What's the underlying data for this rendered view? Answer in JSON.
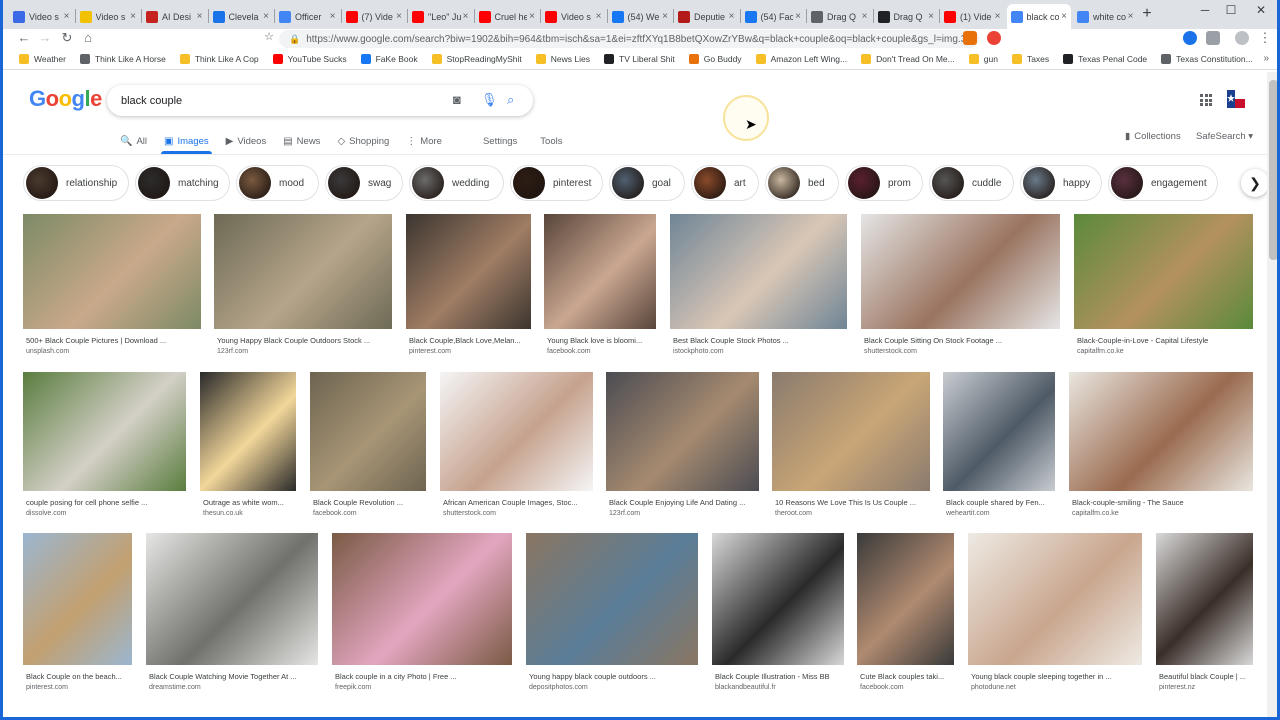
{
  "browser": {
    "tabs": [
      {
        "title": "Video s",
        "fav": "#3c6ae6"
      },
      {
        "title": "Video s",
        "fav": "#f2c200"
      },
      {
        "title": "AI Desi",
        "fav": "#c5221f"
      },
      {
        "title": "Clevela",
        "fav": "#1a73e8"
      },
      {
        "title": "Officer",
        "fav": "#4285f4"
      },
      {
        "title": "(7) Vide",
        "fav": "#ff0000"
      },
      {
        "title": "\"Leo\" Ju",
        "fav": "#ff0000"
      },
      {
        "title": "Cruel he",
        "fav": "#ff0000"
      },
      {
        "title": "Video s",
        "fav": "#ff0000"
      },
      {
        "title": "(54) We",
        "fav": "#1877f2"
      },
      {
        "title": "Deputie",
        "fav": "#b31b1b"
      },
      {
        "title": "(54) Fac",
        "fav": "#1877f2"
      },
      {
        "title": "Drag Q",
        "fav": "#5f6368"
      },
      {
        "title": "Drag Q",
        "fav": "#202124"
      },
      {
        "title": "(1) Vide",
        "fav": "#ff0000"
      },
      {
        "title": "black co",
        "fav": "#4285f4",
        "active": true
      },
      {
        "title": "white co",
        "fav": "#4285f4"
      }
    ],
    "url": "https://www.google.com/search?biw=1902&bih=964&tbm=isch&sa=1&ei=zftfXYq1B8betQXowZrYBw&q=black+couple&oq=black+couple&gs_l=img.3...0...",
    "bookmarks": [
      {
        "label": "Weather",
        "color": "#f6bf26"
      },
      {
        "label": "Think Like A Horse",
        "color": "#5f6368"
      },
      {
        "label": "Think Like A Cop",
        "color": "#f6bf26"
      },
      {
        "label": "YouTube Sucks",
        "color": "#ff0000"
      },
      {
        "label": "FaKe Book",
        "color": "#1877f2"
      },
      {
        "label": "StopReadingMyShit",
        "color": "#f6bf26"
      },
      {
        "label": "News Lies",
        "color": "#f6bf26"
      },
      {
        "label": "TV Liberal Shit",
        "color": "#202124"
      },
      {
        "label": "Go Buddy",
        "color": "#e8710a"
      },
      {
        "label": "Amazon Left Wing...",
        "color": "#f6bf26"
      },
      {
        "label": "Don't Tread On Me...",
        "color": "#f6bf26"
      },
      {
        "label": "gun",
        "color": "#f6bf26"
      },
      {
        "label": "Taxes",
        "color": "#f6bf26"
      },
      {
        "label": "Texas Penal Code",
        "color": "#202124"
      },
      {
        "label": "Texas Constitution...",
        "color": "#5f6368"
      }
    ],
    "more_bookmarks": "»"
  },
  "google": {
    "logo": [
      "G",
      "o",
      "o",
      "g",
      "l",
      "e"
    ],
    "logo_colors": [
      "#4285f4",
      "#ea4335",
      "#fbbc05",
      "#4285f4",
      "#34a853",
      "#ea4335"
    ],
    "query": "black couple",
    "tabs": [
      {
        "label": "All",
        "icon": "🔍"
      },
      {
        "label": "Images",
        "icon": "▣",
        "active": true
      },
      {
        "label": "Videos",
        "icon": "▶"
      },
      {
        "label": "News",
        "icon": "▤"
      },
      {
        "label": "Shopping",
        "icon": "◇"
      },
      {
        "label": "More",
        "icon": "⋮"
      }
    ],
    "settings": "Settings",
    "tools": "Tools",
    "collections": "Collections",
    "safesearch": "SafeSearch ▾"
  },
  "chips": [
    "relationship",
    "matching",
    "mood",
    "swag",
    "wedding",
    "pinterest",
    "goal",
    "art",
    "bed",
    "prom",
    "cuddle",
    "happy",
    "engagement"
  ],
  "results": [
    {
      "title": "500+ Black Couple Pictures | Download ...",
      "source": "unsplash.com"
    },
    {
      "title": "Young Happy Black Couple Outdoors Stock ...",
      "source": "123rf.com"
    },
    {
      "title": "Black Couple,Black Love,Melan...",
      "source": "pinterest.com"
    },
    {
      "title": "Young Black love is bloomi...",
      "source": "facebook.com"
    },
    {
      "title": "Best Black Couple Stock Photos ...",
      "source": "istockphoto.com"
    },
    {
      "title": "Black Couple Sitting On Stock Footage ...",
      "source": "shutterstock.com"
    },
    {
      "title": "Black-Couple-in-Love - Capital Lifestyle",
      "source": "capitalfm.co.ke"
    },
    {
      "title": "couple posing for cell phone selfie ...",
      "source": "dissolve.com"
    },
    {
      "title": "Outrage as white wom...",
      "source": "thesun.co.uk"
    },
    {
      "title": "Black Couple Revolution ...",
      "source": "facebook.com"
    },
    {
      "title": "African American Couple Images, Stoc...",
      "source": "shutterstock.com"
    },
    {
      "title": "Black Couple Enjoying Life And Dating ...",
      "source": "123rf.com"
    },
    {
      "title": "10 Reasons We Love This Is Us Couple ...",
      "source": "theroot.com"
    },
    {
      "title": "Black couple shared by Fen...",
      "source": "weheartit.com"
    },
    {
      "title": "Black-couple-smiling - The Sauce",
      "source": "capitalfm.co.ke"
    },
    {
      "title": "Black Couple on the beach...",
      "source": "pinterest.com"
    },
    {
      "title": "Black Couple Watching Movie Together At ...",
      "source": "dreamstime.com"
    },
    {
      "title": "Black couple in a city Photo | Free ...",
      "source": "freepik.com"
    },
    {
      "title": "Young happy black couple outdoors ...",
      "source": "depositphotos.com"
    },
    {
      "title": "Black Couple Illustration - Miss BB",
      "source": "blackandbeautiful.fr"
    },
    {
      "title": "Cute Black couples taki...",
      "source": "facebook.com"
    },
    {
      "title": "Young black couple sleeping together in ...",
      "source": "photodune.net"
    },
    {
      "title": "Beautiful black Couple | ...",
      "source": "pinterest.nz"
    }
  ]
}
